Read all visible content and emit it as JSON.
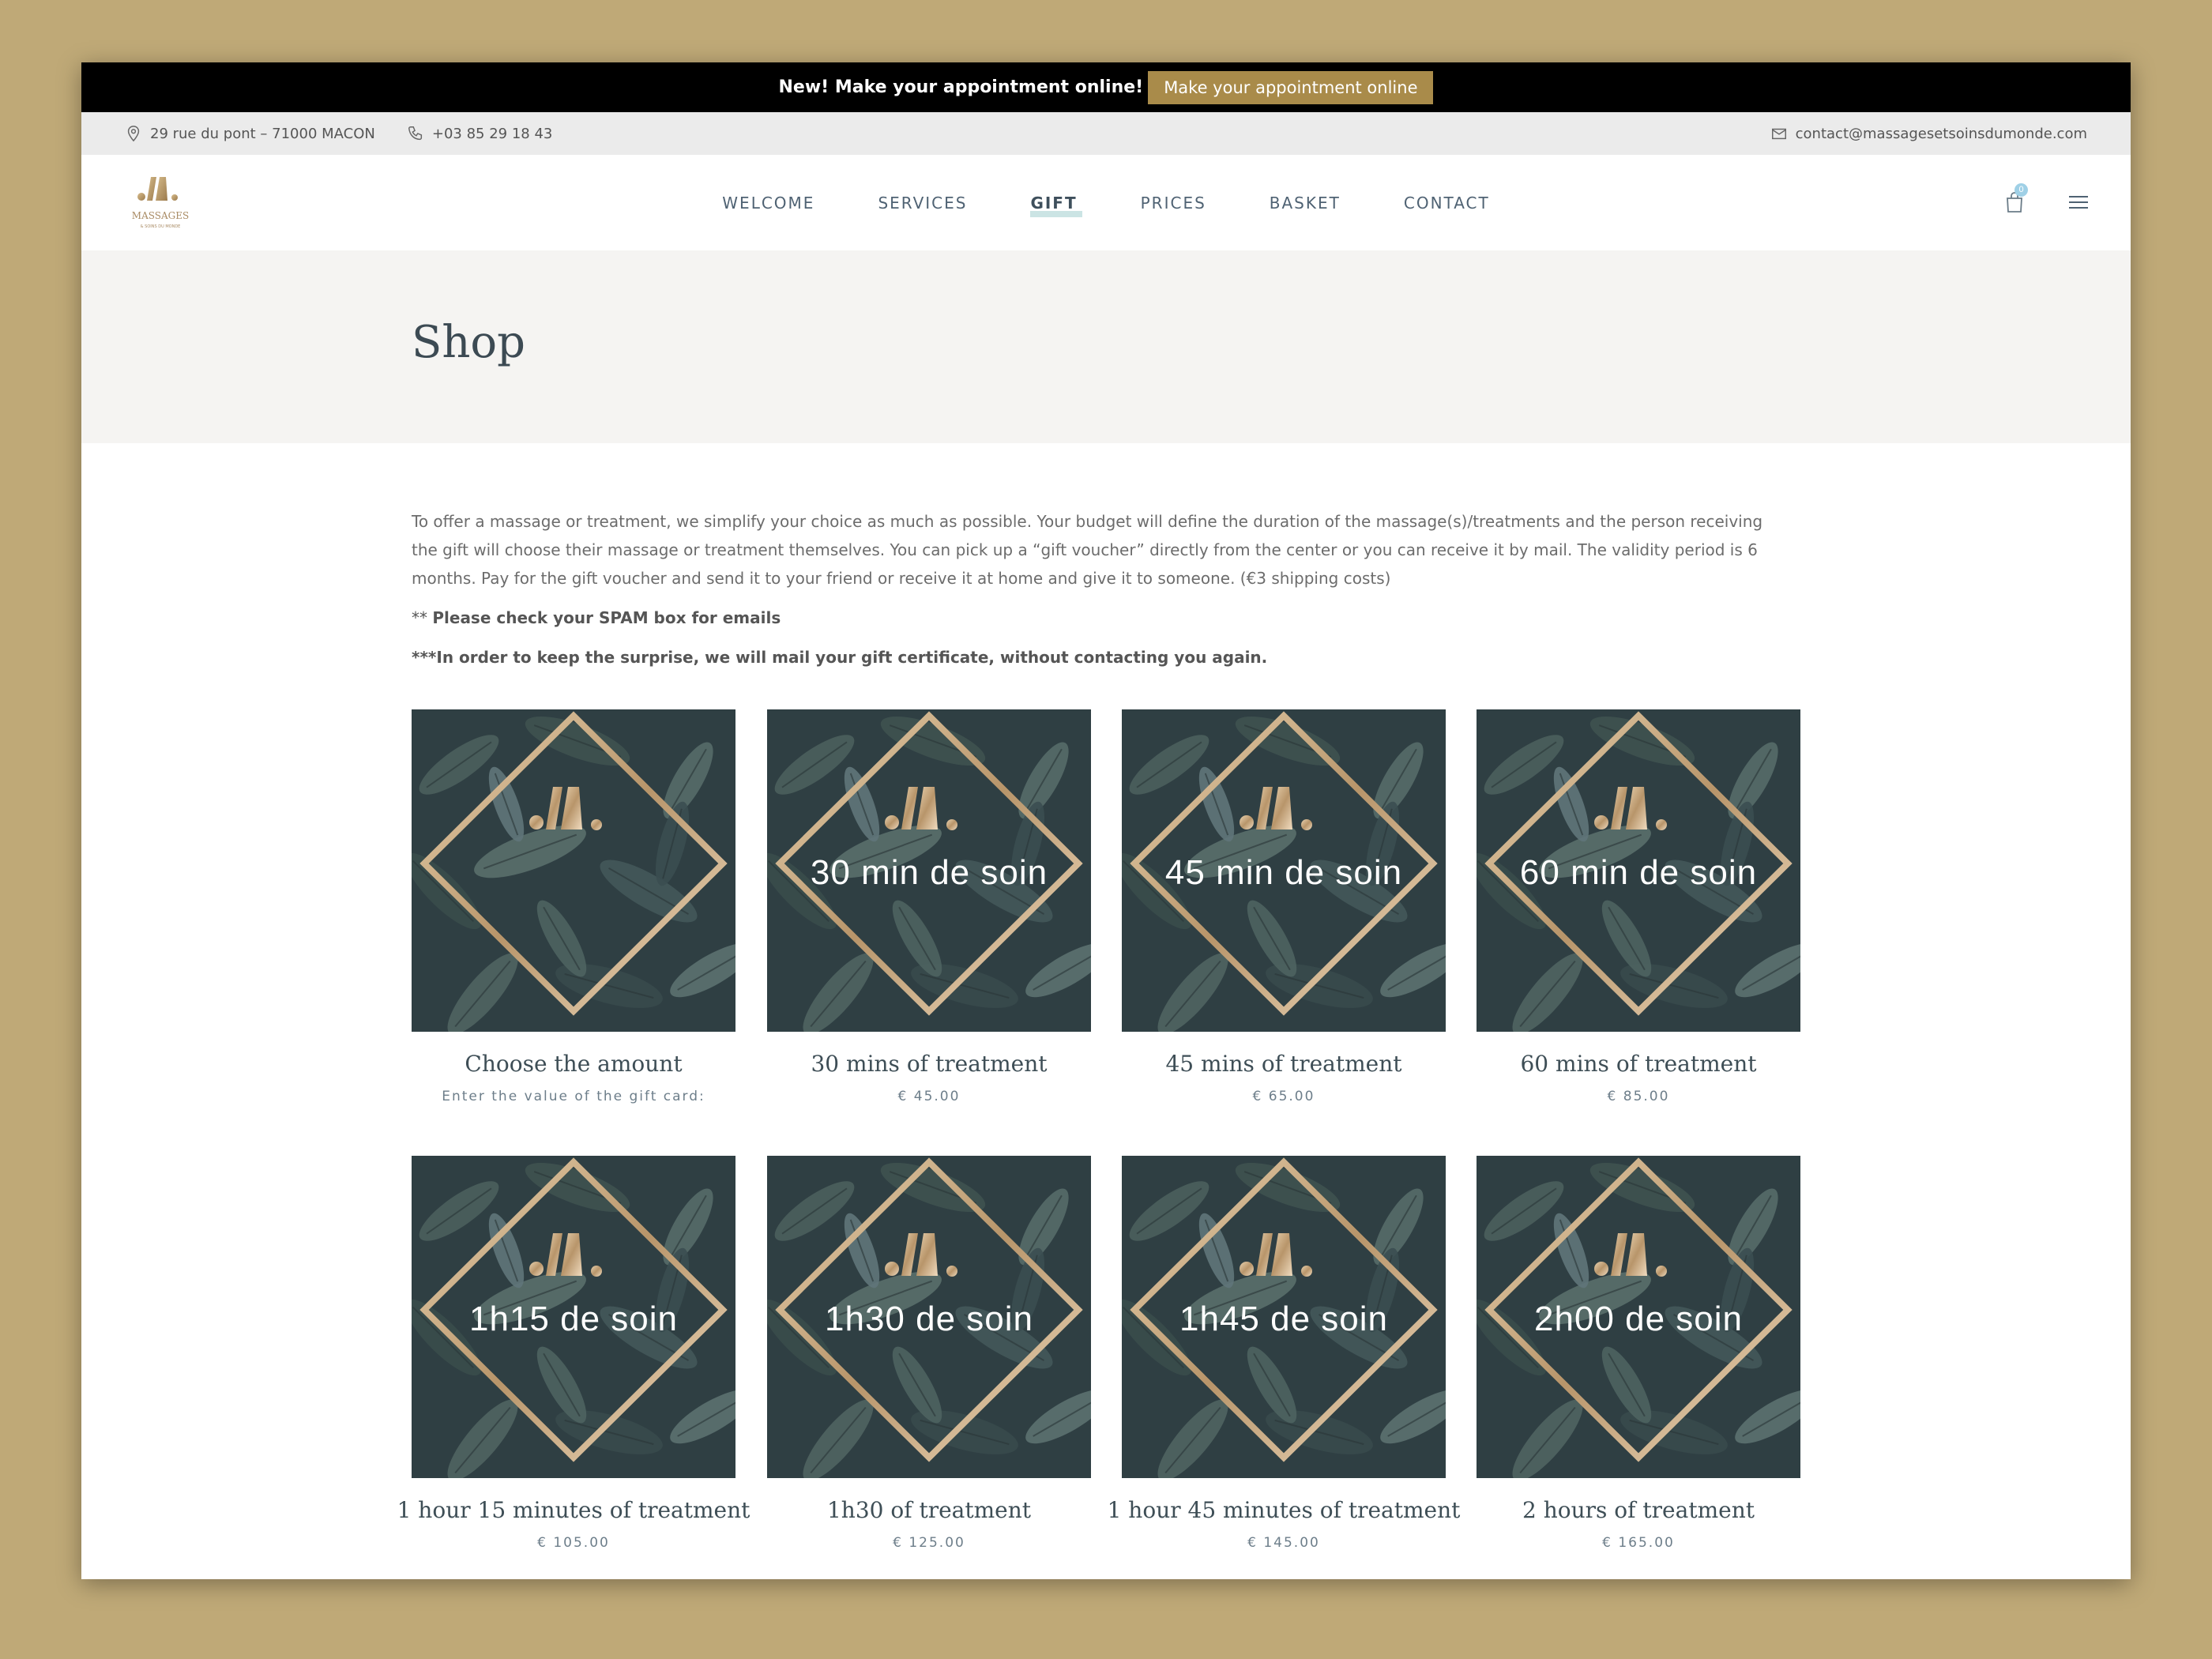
{
  "promo": {
    "text": "New! Make your appointment online!",
    "button": "Make your appointment online"
  },
  "contact": {
    "address": "29 rue du pont – 71000 MACON",
    "phone": "+03 85 29 18 43",
    "email": "contact@massagesetsoinsdumonde.com"
  },
  "nav": {
    "items": [
      "WELCOME",
      "SERVICES",
      "GIFT",
      "PRICES",
      "BASKET",
      "CONTACT"
    ],
    "active": "GIFT"
  },
  "cart": {
    "count": "0"
  },
  "logo": {
    "name": "MASSAGES",
    "tagline": "& SOINS DU MONDE"
  },
  "page": {
    "title": "Shop"
  },
  "intro": {
    "text": "To offer a massage or treatment, we simplify your choice as much as possible. Your budget will define the duration of the massage(s)/treatments and the person receiving the gift will choose their massage or treatment themselves. You can pick up a “gift voucher” directly from the center or you can receive it by mail. The validity period is 6 months. Pay for the gift voucher and send it to your friend or receive it at home and give it to someone. (€3 shipping costs)",
    "spam_prefix": "** ",
    "spam_note": "Please check your SPAM box for emails",
    "surprise_note": "***In order to keep the surprise, we will mail your gift certificate, without contacting you again."
  },
  "products": [
    {
      "overlay": "",
      "name": "Choose the amount",
      "price": "Enter the value of the gift card:"
    },
    {
      "overlay": "30 min  de soin",
      "name": "30 mins of treatment",
      "price": "€ 45.00"
    },
    {
      "overlay": "45 min  de soin",
      "name": "45 mins of treatment",
      "price": "€ 65.00"
    },
    {
      "overlay": "60 min  de soin",
      "name": "60 mins of treatment",
      "price": "€ 85.00"
    },
    {
      "overlay": "1h15 de soin",
      "name": "1 hour 15 minutes of treatment",
      "price": "€ 105.00"
    },
    {
      "overlay": "1h30 de soin",
      "name": "1h30 of treatment",
      "price": "€ 125.00"
    },
    {
      "overlay": "1h45 de soin",
      "name": "1 hour 45 minutes of treatment",
      "price": "€ 145.00"
    },
    {
      "overlay": "2h00 de soin",
      "name": "2 hours of treatment",
      "price": "€ 165.00"
    }
  ],
  "colors": {
    "background": "#bfa977",
    "gold": "#a98b4a",
    "promo_bar": "#000000",
    "leaf_dark": "#35474a"
  }
}
